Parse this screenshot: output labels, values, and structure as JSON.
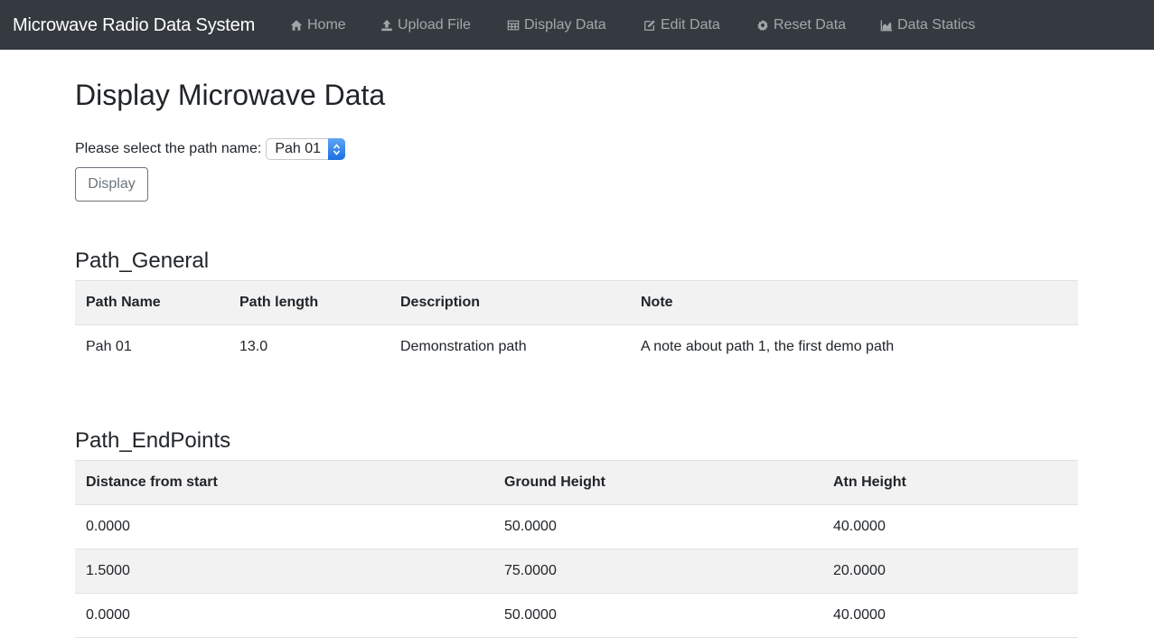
{
  "navbar": {
    "brand": "Microwave Radio Data System",
    "items": [
      {
        "label": "Home",
        "icon": "home-icon"
      },
      {
        "label": "Upload File",
        "icon": "upload-icon"
      },
      {
        "label": "Display Data",
        "icon": "table-icon"
      },
      {
        "label": "Edit Data",
        "icon": "edit-icon"
      },
      {
        "label": "Reset Data",
        "icon": "gear-icon"
      },
      {
        "label": "Data Statics",
        "icon": "area-chart-icon"
      }
    ]
  },
  "main": {
    "title": "Display Microwave Data",
    "select_label": "Please select the path name:",
    "selected_path": "Pah 01",
    "display_button": "Display"
  },
  "path_general": {
    "title": "Path_General",
    "headers": [
      "Path Name",
      "Path length",
      "Description",
      "Note"
    ],
    "rows": [
      [
        "Pah 01",
        "13.0",
        "Demonstration path",
        "A note about path 1, the first demo path"
      ]
    ]
  },
  "path_endpoints": {
    "title": "Path_EndPoints",
    "headers": [
      "Distance from start",
      "Ground Height",
      "Atn Height"
    ],
    "rows": [
      [
        "0.0000",
        "50.0000",
        "40.0000"
      ],
      [
        "1.5000",
        "75.0000",
        "20.0000"
      ],
      [
        "0.0000",
        "50.0000",
        "40.0000"
      ]
    ]
  },
  "colors": {
    "navbar_bg": "#343a40",
    "select_accent": "#1b6fe0",
    "stripe": "#f2f2f2"
  }
}
